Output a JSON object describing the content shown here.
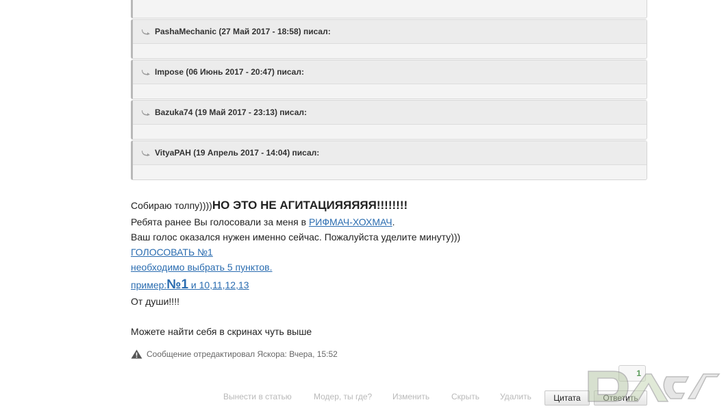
{
  "quotes": [
    {
      "header": "PashaMechanic (27 Май 2017 - 18:58) писал:"
    },
    {
      "header": "Impose (06 Июнь 2017 - 20:47) писал:"
    },
    {
      "header": "Bazuka74 (19 Май 2017 - 23:13) писал:"
    },
    {
      "header": "VityaPAH (19 Апрель 2017 - 14:04) писал:"
    }
  ],
  "post": {
    "line1_text": "Собираю толпу))))",
    "line1_bold": "НО ЭТО НЕ АГИТАЦИЯЯЯЯЯ!!!!!!!!",
    "line2_text": "Ребята ранее Вы голосовали за меня в ",
    "line2_link": "РИФМАЧ-ХОХМАЧ",
    "line2_end": ".",
    "line3": "Ваш голос оказался нужен именно сейчас. Пожалуйста уделите минуту)))",
    "vote_link": "ГОЛОСОВАТЬ №1",
    "choose_link": "необходимо выбрать 5 пунктов.",
    "example_prefix": "пример:",
    "example_num": "№1",
    "example_rest": " и 10,11,12,13",
    "line7": "От души!!!!",
    "line8": "Можете найти себя в скринах чуть выше"
  },
  "edit_note": "Сообщение отредактировал Яскора: Вчера, 15:52",
  "reputation": "1",
  "actions": {
    "to_article": "Вынести в статью",
    "moder": "Модер, ты где?",
    "edit": "Изменить",
    "hide": "Скрыть",
    "delete": "Удалить",
    "quote": "Цитата",
    "reply": "Ответить"
  },
  "icons": {
    "quote_icon": "quote-arrow-icon",
    "warning_icon": "warning-icon",
    "watermark": "logo-watermark"
  }
}
